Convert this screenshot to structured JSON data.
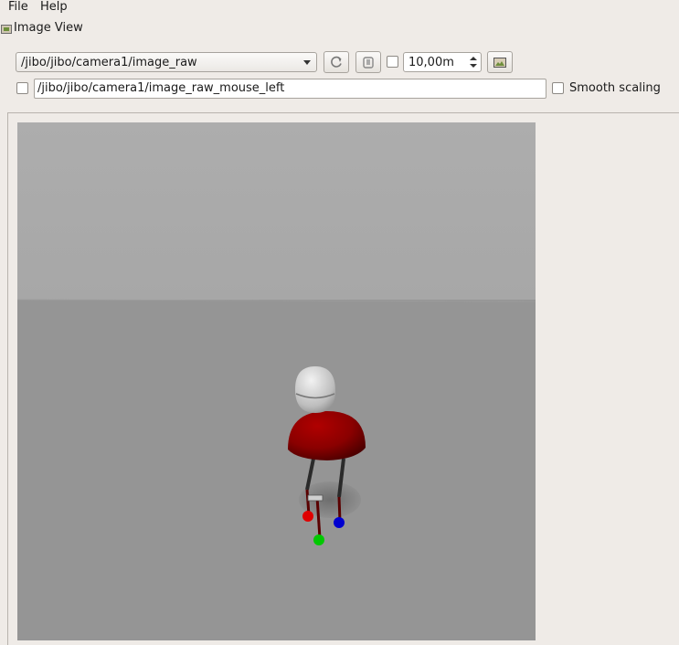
{
  "menu": {
    "file": "File",
    "help": "Help"
  },
  "plugin": {
    "title": "Image View"
  },
  "toolbar": {
    "topic": "/jibo/jibo/camera1/image_raw",
    "refresh_icon": "refresh-icon",
    "zoom_icon": "zoom-icon",
    "spin_value": "10,00m",
    "save_icon": "save-image-icon"
  },
  "mouse": {
    "topic_value": "/jibo/jibo/camera1/image_raw_mouse_left"
  },
  "options": {
    "smooth_scaling": "Smooth scaling"
  },
  "image": {
    "sky_color": "#aaaaaa",
    "floor_color": "#959595",
    "body_color": "#8a0000",
    "head_color": "#d8d8d8",
    "marker_colors": [
      "#e00000",
      "#00c800",
      "#0000d0"
    ]
  }
}
